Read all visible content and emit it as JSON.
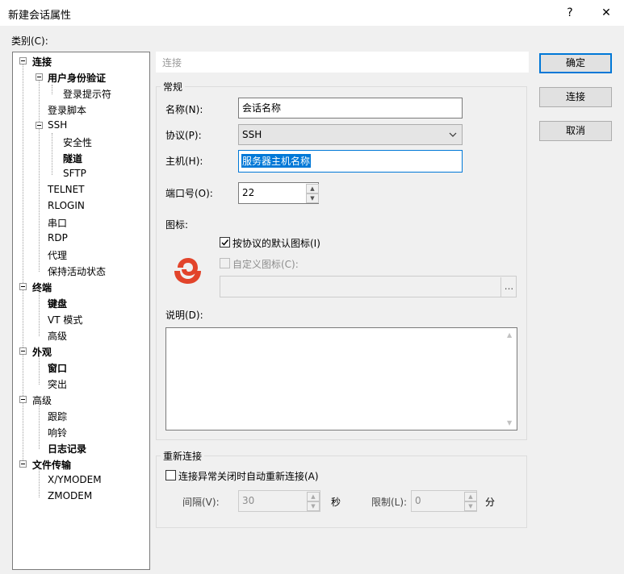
{
  "window": {
    "title": "新建会话属性",
    "help_glyph": "?",
    "close_glyph": "✕"
  },
  "category_label": "类别(C):",
  "tree": [
    {
      "label": "连接",
      "bold": true
    },
    {
      "label": "用户身份验证",
      "bold": true
    },
    {
      "label": "登录提示符",
      "bold": false
    },
    {
      "label": "登录脚本",
      "bold": false
    },
    {
      "label": "SSH",
      "bold": false
    },
    {
      "label": "安全性",
      "bold": false
    },
    {
      "label": "隧道",
      "bold": true
    },
    {
      "label": "SFTP",
      "bold": false
    },
    {
      "label": "TELNET",
      "bold": false
    },
    {
      "label": "RLOGIN",
      "bold": false
    },
    {
      "label": "串口",
      "bold": false
    },
    {
      "label": "RDP",
      "bold": false
    },
    {
      "label": "代理",
      "bold": false
    },
    {
      "label": "保持活动状态",
      "bold": false
    },
    {
      "label": "终端",
      "bold": true
    },
    {
      "label": "键盘",
      "bold": true
    },
    {
      "label": "VT 模式",
      "bold": false
    },
    {
      "label": "高级",
      "bold": false
    },
    {
      "label": "外观",
      "bold": true
    },
    {
      "label": "窗口",
      "bold": true
    },
    {
      "label": "突出",
      "bold": false
    },
    {
      "label": "高级",
      "bold": false
    },
    {
      "label": "跟踪",
      "bold": false
    },
    {
      "label": "响铃",
      "bold": false
    },
    {
      "label": "日志记录",
      "bold": true
    },
    {
      "label": "文件传输",
      "bold": true
    },
    {
      "label": "X/YMODEM",
      "bold": false
    },
    {
      "label": "ZMODEM",
      "bold": false
    }
  ],
  "section_header": "连接",
  "general": {
    "group_label": "常规",
    "name_label": "名称(N):",
    "name_value": "会话名称",
    "protocol_label": "协议(P):",
    "protocol_value": "SSH",
    "host_label": "主机(H):",
    "host_value": "服务器主机名称",
    "port_label": "端口号(O):",
    "port_value": "22",
    "icon_label": "图标:",
    "default_icon_label": "按协议的默认图标(I)",
    "custom_icon_label": "自定义图标(C):",
    "browse_glyph": "...",
    "desc_label": "说明(D):"
  },
  "reconnect": {
    "group_label": "重新连接",
    "auto_label": "连接异常关闭时自动重新连接(A)",
    "interval_label": "间隔(V):",
    "interval_value": "30",
    "interval_unit": "秒",
    "limit_label": "限制(L):",
    "limit_value": "0",
    "limit_unit": "分"
  },
  "buttons": {
    "ok": "确定",
    "connect": "连接",
    "cancel": "取消"
  },
  "colors": {
    "accent": "#0078d7",
    "logo": "#e2442b"
  }
}
